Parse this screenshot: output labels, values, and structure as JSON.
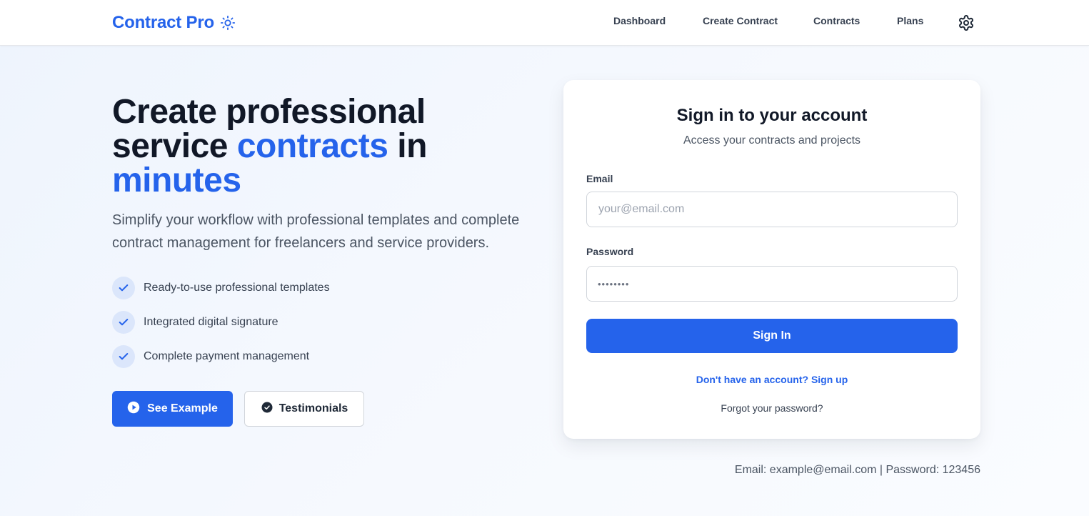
{
  "header": {
    "brand": "Contract Pro",
    "brand_icon": "sun-icon",
    "nav": [
      {
        "label": "Dashboard"
      },
      {
        "label": "Create Contract"
      },
      {
        "label": "Contracts"
      },
      {
        "label": "Plans"
      }
    ],
    "settings_icon": "gear-icon"
  },
  "hero": {
    "title_part1": "Create professional service ",
    "title_accent1": "contracts",
    "title_part2": " in ",
    "title_accent2": "minutes",
    "subtitle": "Simplify your workflow with professional templates and complete contract management for freelancers and service providers.",
    "features": [
      {
        "label": "Ready-to-use professional templates",
        "icon": "check-icon"
      },
      {
        "label": "Integrated digital signature",
        "icon": "check-icon"
      },
      {
        "label": "Complete payment management",
        "icon": "check-icon"
      }
    ],
    "primary_button": {
      "label": "See Example",
      "icon": "play-icon"
    },
    "secondary_button": {
      "label": "Testimonials",
      "icon": "badge-check-icon"
    }
  },
  "login": {
    "title": "Sign in to your account",
    "subtitle": "Access your contracts and projects",
    "email_label": "Email",
    "email_placeholder": "your@email.com",
    "email_value": "",
    "password_label": "Password",
    "password_masked": "••••••••",
    "submit_label": "Sign In",
    "signup_link": "Don't have an account? Sign up",
    "forgot_link": "Forgot your password?"
  },
  "demo_credentials": "Email: example@email.com | Password: 123456",
  "colors": {
    "accent": "#2563eb",
    "text_dark": "#111827",
    "text_muted": "#4b5563",
    "check_bg": "#dbe6fb"
  }
}
